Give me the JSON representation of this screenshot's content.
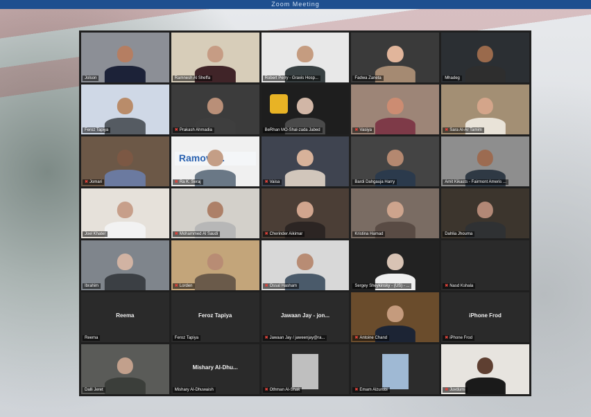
{
  "window": {
    "banner_text": "Zoom Meeting"
  },
  "colors": {
    "active_speaker": "#b9d65a",
    "muted_icon": "#e0433b",
    "grid_bg": "#1f1f1f"
  },
  "participants": [
    {
      "name": "Jolson",
      "muted": false,
      "video": true,
      "bg": "#8c8f96",
      "skin": "#b57e62",
      "shirt": "#1c2238"
    },
    {
      "name": "Ramnesh Al Sheffa",
      "muted": false,
      "video": true,
      "bg": "#d7cdb9",
      "skin": "#c69c84",
      "shirt": "#402428"
    },
    {
      "name": "Robert Perry - Gravis Hosp...",
      "muted": false,
      "video": true,
      "bg": "#e8e8e8",
      "skin": "#c59c80",
      "shirt": "#384042"
    },
    {
      "name": "Fadwa Zaneta",
      "muted": false,
      "video": true,
      "bg": "#3a3a3a",
      "skin": "#e1b59b",
      "shirt": "#a58a72"
    },
    {
      "name": "Mhadeg",
      "muted": false,
      "video": true,
      "bg": "#2b2f33",
      "skin": "#9a6a4c",
      "shirt": "#2e2e2e",
      "active": true
    },
    {
      "name": "Feroz Tapiya",
      "muted": false,
      "video": true,
      "bg": "#cfd8e6",
      "skin": "#b98c6a",
      "shirt": "#555b62"
    },
    {
      "name": "Prakash Ahmadia",
      "muted": true,
      "video": true,
      "bg": "#3c3c3c",
      "skin": "#b98f78",
      "shirt": "#3e3e3e"
    },
    {
      "name": "BeRhan MO-Shal-zada Jabed",
      "muted": false,
      "video": true,
      "bg": "#1e1e1e",
      "skin": "#d1b6a6",
      "shirt": "#4a4a4a",
      "sign": true
    },
    {
      "name": "Vasiya",
      "muted": true,
      "video": true,
      "bg": "#9d8577",
      "skin": "#cc8c72",
      "shirt": "#7e3a48"
    },
    {
      "name": "Sara Al-Ar Tamim",
      "muted": true,
      "video": true,
      "bg": "#a38f74",
      "skin": "#d4a58a",
      "shirt": "#e9e3d8"
    },
    {
      "name": "Jomari",
      "muted": true,
      "video": true,
      "bg": "#6c5847",
      "skin": "#7c5844",
      "shirt": "#6b7aa0"
    },
    {
      "name": "Ra K. Seraj",
      "muted": true,
      "video": true,
      "bg": "#f0f0f0",
      "skin": "#c49e86",
      "shirt": "#6a7886",
      "banner": "Ramoves."
    },
    {
      "name": "Vaisa",
      "muted": true,
      "video": true,
      "bg": "#3f4450",
      "skin": "#d7b29a",
      "shirt": "#d1c6bb"
    },
    {
      "name": "Bardi Dahgauja Harry",
      "muted": false,
      "video": true,
      "bg": "#444",
      "skin": "#b48870",
      "shirt": "#2b3a4c"
    },
    {
      "name": "Amit Kikasts - Fairmont Ameris ...",
      "muted": false,
      "video": true,
      "bg": "#8e8e8e",
      "skin": "#9c6b51",
      "shirt": "#2f3944"
    },
    {
      "name": "Joel Khater",
      "muted": false,
      "video": true,
      "bg": "#e6e1da",
      "skin": "#c79f8a",
      "shirt": "#f2f2f2"
    },
    {
      "name": "Mohammed Al Saudi",
      "muted": true,
      "video": true,
      "bg": "#d3d0ca",
      "skin": "#ad8068",
      "shirt": "#b7b7b7"
    },
    {
      "name": "Cherinder Aikimar",
      "muted": true,
      "video": true,
      "bg": "#4b3e36",
      "skin": "#d1a58e",
      "shirt": "#2c2523"
    },
    {
      "name": "Kristina Hamad",
      "muted": false,
      "video": true,
      "bg": "#7a6c63",
      "skin": "#cda48d",
      "shirt": "#594b44"
    },
    {
      "name": "Dahlia Jhouma",
      "muted": false,
      "video": true,
      "bg": "#3c352d",
      "skin": "#b28876",
      "shirt": "#2f3133"
    },
    {
      "name": "Ibrahim",
      "muted": false,
      "video": true,
      "bg": "#7f858c",
      "skin": "#d1b3a3",
      "shirt": "#3b3f44"
    },
    {
      "name": "Lorden",
      "muted": true,
      "video": true,
      "bg": "#c3a57a",
      "skin": "#b88c74",
      "shirt": "#6a5a4a"
    },
    {
      "name": "Ossal Hasham",
      "muted": true,
      "video": true,
      "bg": "#d8d8d8",
      "skin": "#b88c74",
      "shirt": "#4a5a6a"
    },
    {
      "name": "Sergey Sheykinsky - (US) - ...",
      "muted": false,
      "video": true,
      "bg": "#222",
      "skin": "#d8c3b4",
      "shirt": "#efefef",
      "active": true
    },
    {
      "name": "Nasd Kshala",
      "muted": true,
      "video": false,
      "display": ""
    },
    {
      "name": "Reema",
      "muted": false,
      "video": false,
      "display": "Reema"
    },
    {
      "name": "Feroz Tapiya",
      "muted": false,
      "video": false,
      "display": "Feroz Tapiya"
    },
    {
      "name": "Jawaan Jay / jaweenjay@ra...",
      "muted": true,
      "video": false,
      "display": "Jawaan Jay - jon..."
    },
    {
      "name": "Antoine Chand",
      "muted": true,
      "video": true,
      "bg": "#6a4c2c",
      "skin": "#c59b7d",
      "shirt": "#1c2434"
    },
    {
      "name": "iPhone Frod",
      "muted": true,
      "video": false,
      "display": "iPhone Frod"
    },
    {
      "name": "Dalli Jeret",
      "muted": false,
      "video": true,
      "bg": "#5a5b58",
      "skin": "#c2a08c",
      "shirt": "#3b3e3a"
    },
    {
      "name": "Mishary Al-Dhuwaish",
      "muted": false,
      "video": false,
      "display": "Mishary Al-Dhu..."
    },
    {
      "name": "Othman Al-Shak",
      "muted": true,
      "video": true,
      "bg": "#2a2a2a",
      "skin": "#bfbfbf",
      "shirt": "#cfcfcf",
      "thumb": true
    },
    {
      "name": "Emam Alzurobi",
      "muted": true,
      "video": true,
      "bg": "#2c2c2c",
      "skin": "#9fb9d4",
      "shirt": "#3d5a80",
      "thumb": true
    },
    {
      "name": "Juvdumi",
      "muted": true,
      "video": true,
      "bg": "#e7e4df",
      "skin": "#5e3f31",
      "shirt": "#1a1a1a"
    }
  ]
}
